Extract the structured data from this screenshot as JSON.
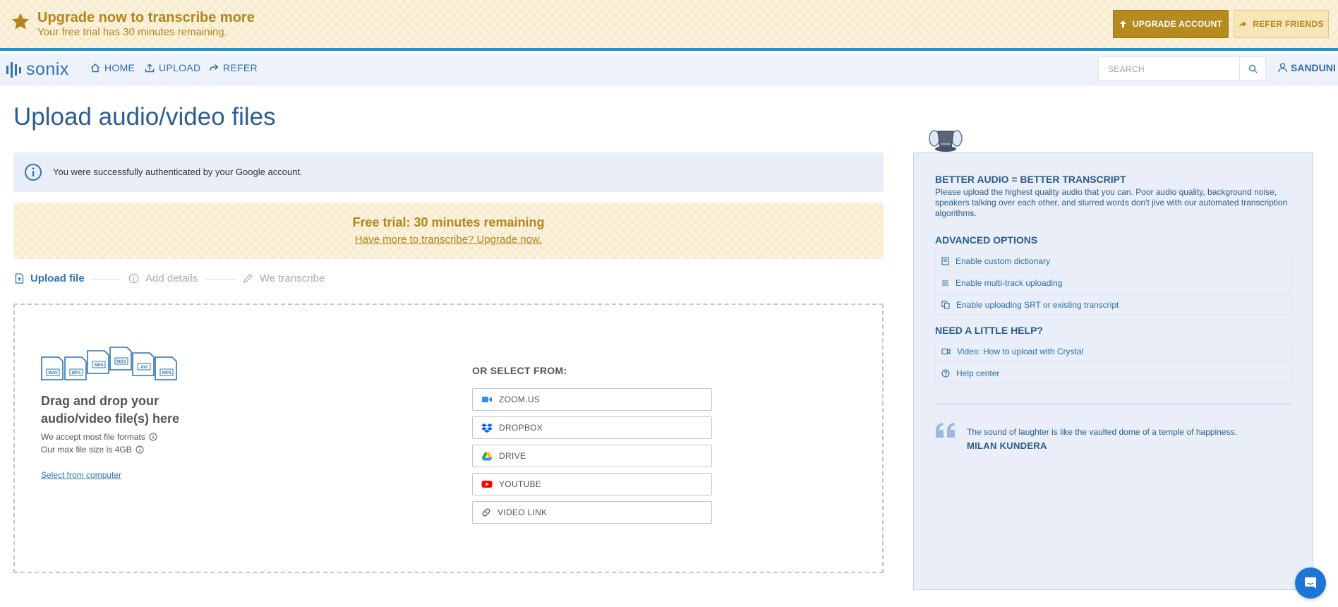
{
  "banner": {
    "title": "Upgrade now to transcribe more",
    "subtitle": "Your free trial has 30 minutes remaining.",
    "upgrade_label": "UPGRADE ACCOUNT",
    "refer_label": "REFER FRIENDS"
  },
  "nav": {
    "logo": "sonix",
    "items": [
      {
        "label": "HOME",
        "icon": "home-icon"
      },
      {
        "label": "UPLOAD",
        "icon": "upload-icon"
      },
      {
        "label": "REFER",
        "icon": "share-icon"
      }
    ],
    "search_placeholder": "SEARCH",
    "user": "SANDUNI"
  },
  "page": {
    "title": "Upload audio/video files",
    "alert": "You were successfully authenticated by your Google account.",
    "trial_title": "Free trial: 30 minutes remaining",
    "trial_link": "Have more to transcribe? Upgrade now."
  },
  "steps": [
    {
      "label": "Upload file",
      "icon": "file-upload-icon",
      "active": true
    },
    {
      "label": "Add details",
      "icon": "info-icon",
      "active": false
    },
    {
      "label": "We transcribe",
      "icon": "pencil-icon",
      "active": false
    }
  ],
  "dropzone": {
    "file_types": [
      "WAV",
      "MP3",
      "MP4",
      "MOV",
      "AVI",
      "MP4"
    ],
    "title": "Drag and drop your audio/video file(s) here",
    "formats": "We accept most file formats",
    "max_size": "Our max file size is 4GB",
    "select_link": "Select from computer",
    "or_select": "OR SELECT FROM:",
    "sources": [
      {
        "label": "ZOOM.US",
        "icon": "zoom-icon"
      },
      {
        "label": "DROPBOX",
        "icon": "dropbox-icon"
      },
      {
        "label": "DRIVE",
        "icon": "google-drive-icon"
      },
      {
        "label": "YOUTUBE",
        "icon": "youtube-icon"
      },
      {
        "label": "VIDEO LINK",
        "icon": "link-icon"
      }
    ]
  },
  "sidebar": {
    "better_audio_title": "BETTER AUDIO = BETTER TRANSCRIPT",
    "better_audio_text": "Please upload the highest quality audio that you can. Poor audio quality, background noise, speakers talking over each other, and slurred words don't jive with our automated transcription algorithms.",
    "advanced_title": "ADVANCED OPTIONS",
    "advanced_items": [
      {
        "label": "Enable custom dictionary",
        "icon": "book-icon"
      },
      {
        "label": "Enable multi-track uploading",
        "icon": "list-icon"
      },
      {
        "label": "Enable uploading SRT or existing transcript",
        "icon": "copy-icon"
      }
    ],
    "help_title": "NEED A LITTLE HELP?",
    "help_items": [
      {
        "label": "Video: How to upload with Crystal",
        "icon": "video-icon"
      },
      {
        "label": "Help center",
        "icon": "question-icon"
      }
    ],
    "quote": "The sound of laughter is like the vaulted dome of a temple of happiness.",
    "quote_author": "MILAN KUNDERA"
  },
  "colors": {
    "brand_blue": "#2f74b5",
    "gold": "#b4851c",
    "upgrade_bg": "#b58a1f",
    "nav_bg": "#eef2fa",
    "sidebar_bg": "#e9eef8",
    "chat": "#1d76d6"
  }
}
